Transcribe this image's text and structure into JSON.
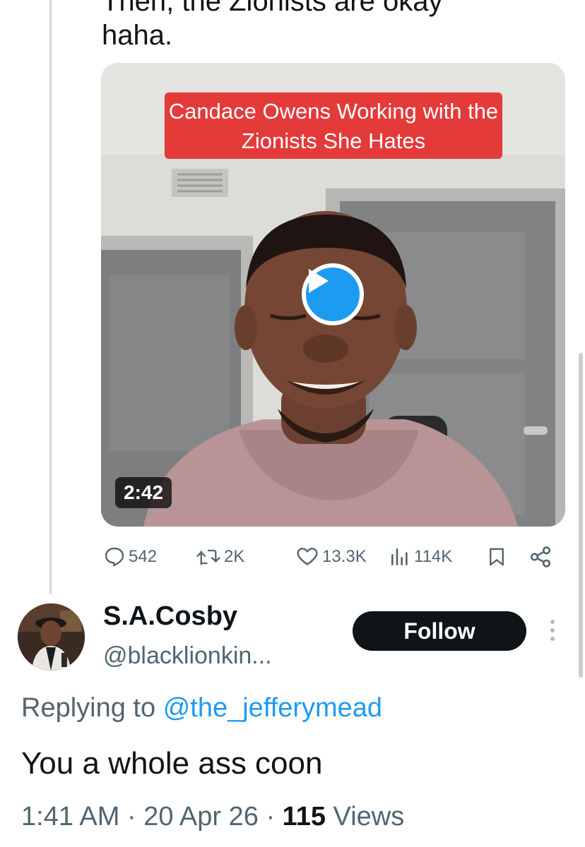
{
  "prev_tweet": {
    "text_cut_top": "Then, the Zionists are okay",
    "text_line": "haha.",
    "video": {
      "caption": "Candace Owens Working with the Zionists She Hates",
      "duration": "2:42"
    },
    "metrics": {
      "replies": "542",
      "reposts": "2K",
      "likes": "13.3K",
      "views": "114K"
    }
  },
  "reply": {
    "display_name": "S.A.Cosby",
    "handle": "@blacklionkin...",
    "follow_label": "Follow",
    "replying_prefix": "Replying to",
    "replying_mention": "@the_jefferymead",
    "text": "You a whole ass coon",
    "time": "1:41 AM",
    "date": "20 Apr 26",
    "views_count": "115",
    "views_label": "Views",
    "separator": "·"
  },
  "colors": {
    "accent": "#1d9bf0",
    "secondary_text": "#536471",
    "caption_bg": "#e53a3a",
    "follow_bg": "#0f1419"
  }
}
